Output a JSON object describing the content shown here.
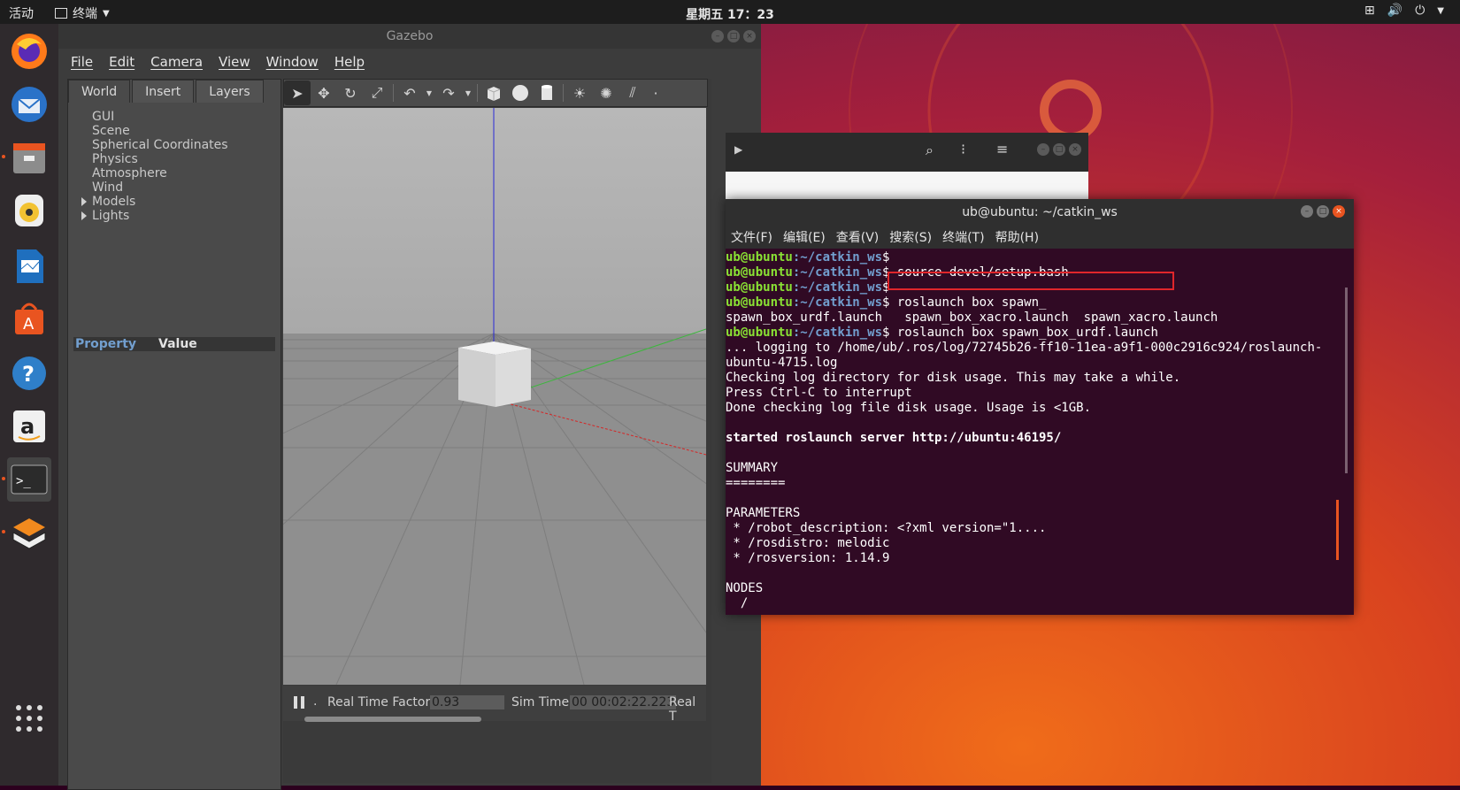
{
  "topbar": {
    "activities": "活动",
    "app_name": "终端",
    "clock": "星期五 17：23"
  },
  "dock": {
    "items": [
      "firefox-icon",
      "thunderbird-icon",
      "files-icon",
      "rhythmbox-icon",
      "writer-icon",
      "software-icon",
      "help-icon",
      "amazon-icon",
      "terminal-icon",
      "sublime-icon"
    ]
  },
  "gazebo": {
    "title": "Gazebo",
    "menu": [
      "File",
      "Edit",
      "Camera",
      "View",
      "Window",
      "Help"
    ],
    "tabs": [
      "World",
      "Insert",
      "Layers"
    ],
    "tree": [
      "GUI",
      "Scene",
      "Spherical Coordinates",
      "Physics",
      "Atmosphere",
      "Wind",
      "Models",
      "Lights"
    ],
    "property_header": "Property",
    "value_header": "Value",
    "status": {
      "rtf_label": "Real Time Factor:",
      "rtf_value": "0.93",
      "sim_label": "Sim Time:",
      "sim_value": "00 00:02:22.223",
      "real_label": "Real T"
    }
  },
  "terminal": {
    "title": "ub@ubuntu: ~/catkin_ws",
    "menu": [
      "文件(F)",
      "编辑(E)",
      "查看(V)",
      "搜索(S)",
      "终端(T)",
      "帮助(H)"
    ],
    "user": "ub@ubuntu",
    "path": ":~/catkin_ws",
    "lines": [
      {
        "type": "prompt",
        "cmd": ""
      },
      {
        "type": "prompt",
        "cmd": " source devel/setup.bash"
      },
      {
        "type": "prompt",
        "cmd": ""
      },
      {
        "type": "prompt",
        "cmd": " roslaunch box spawn_"
      },
      {
        "type": "text",
        "text": "spawn_box_urdf.launch   spawn_box_xacro.launch  spawn_xacro.launch"
      },
      {
        "type": "prompt",
        "cmd": " roslaunch box spawn_box_urdf.launch"
      },
      {
        "type": "text",
        "text": "... logging to /home/ub/.ros/log/72745b26-ff10-11ea-a9f1-000c2916c924/roslaunch-"
      },
      {
        "type": "text",
        "text": "ubuntu-4715.log"
      },
      {
        "type": "text",
        "text": "Checking log directory for disk usage. This may take a while."
      },
      {
        "type": "text",
        "text": "Press Ctrl-C to interrupt"
      },
      {
        "type": "text",
        "text": "Done checking log file disk usage. Usage is <1GB."
      },
      {
        "type": "text",
        "text": ""
      },
      {
        "type": "bold",
        "text": "started roslaunch server http://ubuntu:46195/"
      },
      {
        "type": "text",
        "text": ""
      },
      {
        "type": "text",
        "text": "SUMMARY"
      },
      {
        "type": "text",
        "text": "========"
      },
      {
        "type": "text",
        "text": ""
      },
      {
        "type": "text",
        "text": "PARAMETERS"
      },
      {
        "type": "text",
        "text": " * /robot_description: <?xml version=\"1...."
      },
      {
        "type": "text",
        "text": " * /rosdistro: melodic"
      },
      {
        "type": "text",
        "text": " * /rosversion: 1.14.9"
      },
      {
        "type": "text",
        "text": ""
      },
      {
        "type": "text",
        "text": "NODES"
      },
      {
        "type": "text",
        "text": "  /"
      }
    ]
  }
}
